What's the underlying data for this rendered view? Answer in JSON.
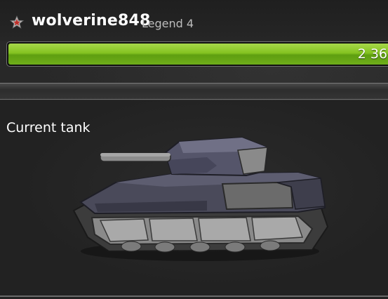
{
  "player": {
    "name": "wolverine848",
    "rank": "Legend 4",
    "rank_icon": "star-icon"
  },
  "experience": {
    "display": "2 36",
    "fill_fraction": 1.0,
    "color": "#84c321"
  },
  "panel": {
    "title": "Current tank"
  },
  "tank": {
    "icon": "tank-icon"
  }
}
